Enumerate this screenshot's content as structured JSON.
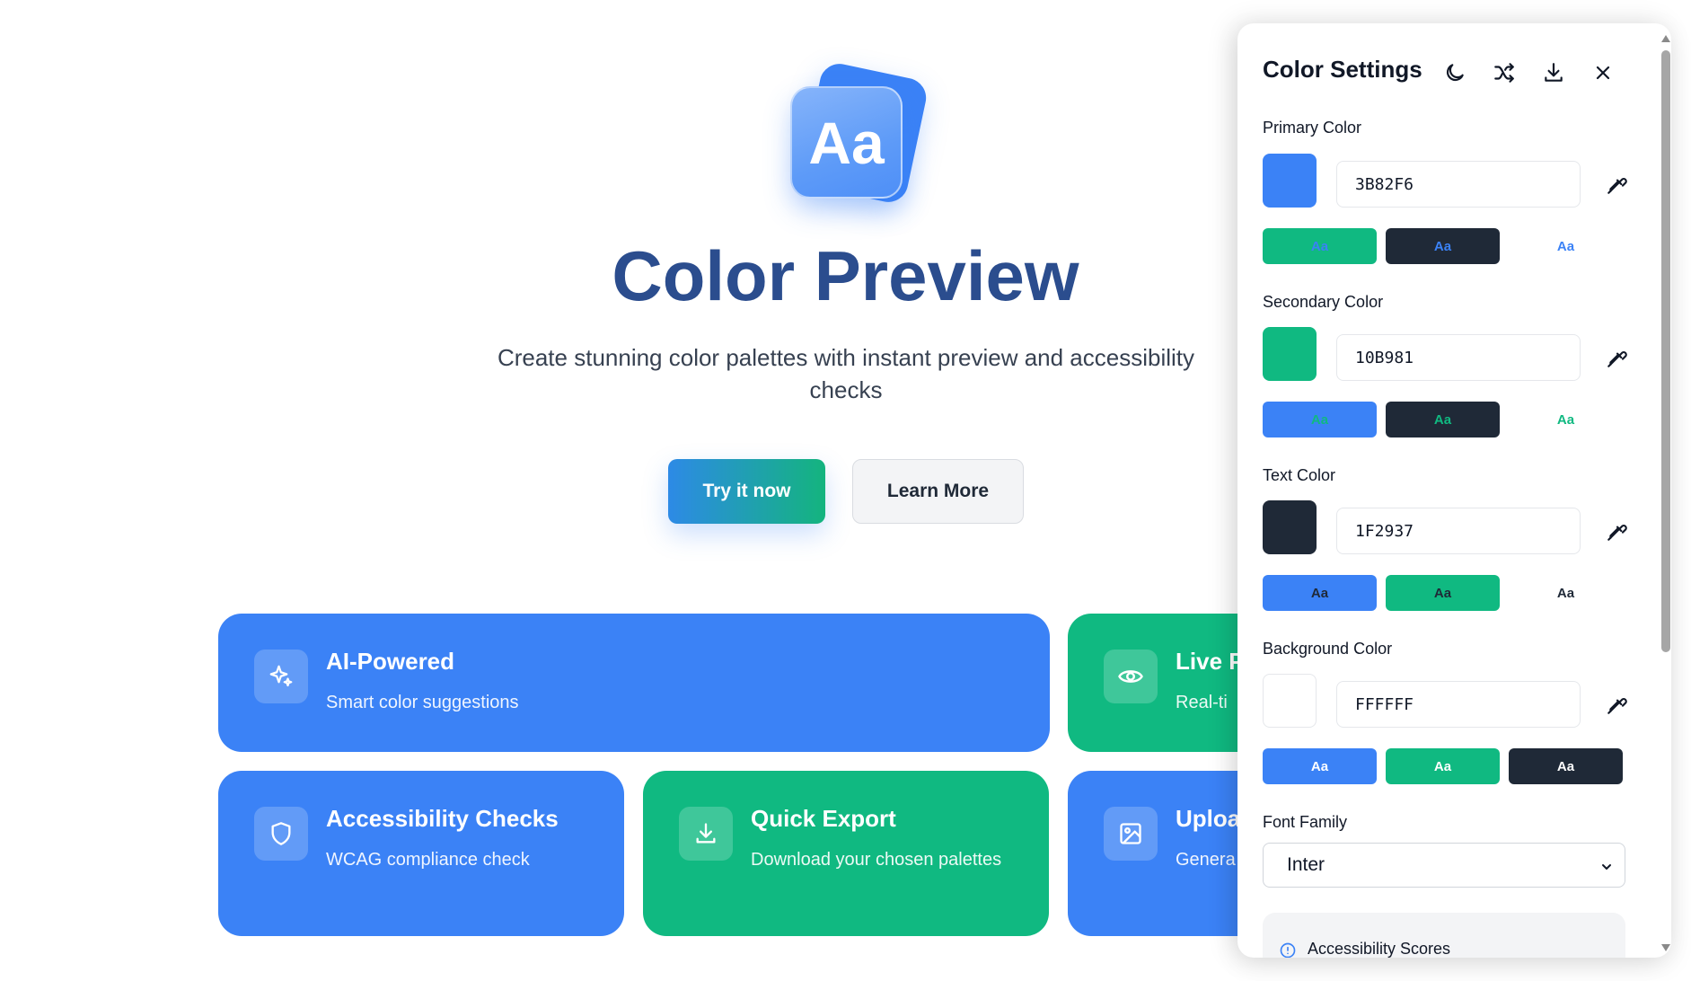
{
  "hero": {
    "logo_text": "Aa",
    "title": "Color Preview",
    "subtitle": "Create stunning color palettes with instant preview and accessibility checks",
    "primary_button": "Try it now",
    "secondary_button": "Learn More"
  },
  "features": [
    {
      "title": "AI-Powered",
      "desc": "Smart color suggestions",
      "icon": "sparkles-icon",
      "color": "blue"
    },
    {
      "title": "Live P",
      "desc": "Real-ti",
      "icon": "eye-icon",
      "color": "green"
    },
    {
      "title": "Accessibility Checks",
      "desc": "WCAG compliance check",
      "icon": "shield-icon",
      "color": "blue"
    },
    {
      "title": "Quick Export",
      "desc": "Download your chosen palettes",
      "icon": "download-icon",
      "color": "green"
    },
    {
      "title": "Uploa",
      "desc": "Genera",
      "icon": "image-icon",
      "color": "blue"
    }
  ],
  "panel": {
    "title": "Color Settings",
    "header_icons": [
      "moon-icon",
      "shuffle-icon",
      "download-icon",
      "close-icon"
    ],
    "colors": [
      {
        "label": "Primary Color",
        "hex": "3B82F6",
        "swatch": "#3B82F6",
        "previews": [
          {
            "text": "Aa",
            "bg": "#10B981",
            "fg": "#3B82F6"
          },
          {
            "text": "Aa",
            "bg": "#1F2937",
            "fg": "#3B82F6"
          },
          {
            "text": "Aa",
            "bg": "#FFFFFF",
            "fg": "#3B82F6"
          }
        ]
      },
      {
        "label": "Secondary Color",
        "hex": "10B981",
        "swatch": "#10B981",
        "previews": [
          {
            "text": "Aa",
            "bg": "#3B82F6",
            "fg": "#10B981"
          },
          {
            "text": "Aa",
            "bg": "#1F2937",
            "fg": "#10B981"
          },
          {
            "text": "Aa",
            "bg": "#FFFFFF",
            "fg": "#10B981"
          }
        ]
      },
      {
        "label": "Text Color",
        "hex": "1F2937",
        "swatch": "#1F2937",
        "previews": [
          {
            "text": "Aa",
            "bg": "#3B82F6",
            "fg": "#1F2937"
          },
          {
            "text": "Aa",
            "bg": "#10B981",
            "fg": "#1F2937"
          },
          {
            "text": "Aa",
            "bg": "#FFFFFF",
            "fg": "#1F2937"
          }
        ]
      },
      {
        "label": "Background Color",
        "hex": "FFFFFF",
        "swatch": "#FFFFFF",
        "previews": [
          {
            "text": "Aa",
            "bg": "#3B82F6",
            "fg": "#FFFFFF"
          },
          {
            "text": "Aa",
            "bg": "#10B981",
            "fg": "#FFFFFF"
          },
          {
            "text": "Aa",
            "bg": "#1F2937",
            "fg": "#FFFFFF"
          }
        ]
      }
    ],
    "font_family_label": "Font Family",
    "font_family_value": "Inter",
    "accessibility_title": "Accessibility Scores"
  },
  "theme": {
    "primary": "#3B82F6",
    "secondary": "#10B981",
    "text": "#1F2937",
    "background": "#FFFFFF"
  }
}
